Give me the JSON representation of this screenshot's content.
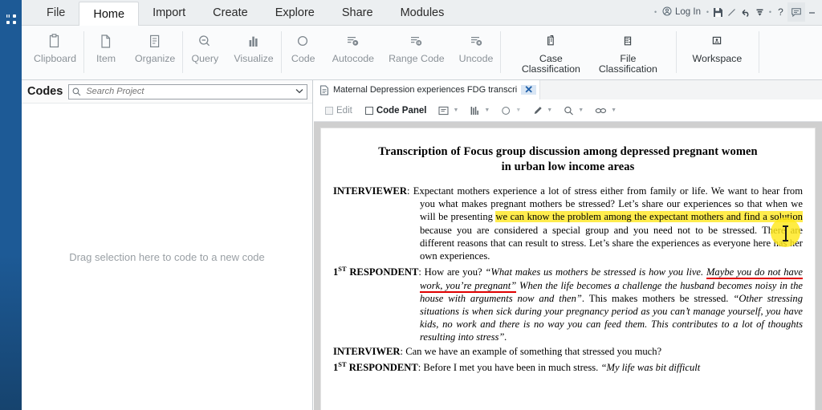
{
  "app": {
    "rail_icon": "apps-grid-icon"
  },
  "ribbon_tabs": [
    {
      "label": "File",
      "active": false
    },
    {
      "label": "Home",
      "active": true
    },
    {
      "label": "Import",
      "active": false
    },
    {
      "label": "Create",
      "active": false
    },
    {
      "label": "Explore",
      "active": false
    },
    {
      "label": "Share",
      "active": false
    },
    {
      "label": "Modules",
      "active": false
    }
  ],
  "top_right": {
    "login_label": "Log In",
    "help_label": "?",
    "icons": [
      "account-circle-icon",
      "save-icon",
      "pencil-icon",
      "undo-icon",
      "redo-dropdown-icon",
      "help-icon",
      "chat-icon",
      "minimize-icon"
    ]
  },
  "ribbon_groups": [
    {
      "buttons": [
        {
          "label": "Clipboard",
          "icon": "clipboard-icon",
          "caret": true,
          "dark": false
        }
      ]
    },
    {
      "buttons": [
        {
          "label": "Item",
          "icon": "file-icon",
          "caret": true,
          "dark": false
        },
        {
          "label": "Organize",
          "icon": "organize-list-icon",
          "caret": true,
          "dark": false
        }
      ]
    },
    {
      "buttons": [
        {
          "label": "Query",
          "icon": "magnifier-icon",
          "caret": true,
          "dark": false
        },
        {
          "label": "Visualize",
          "icon": "bar-chart-icon",
          "caret": true,
          "dark": false
        }
      ]
    },
    {
      "buttons": [
        {
          "label": "Code",
          "icon": "circle-code-icon",
          "caret": true,
          "dark": false
        },
        {
          "label": "Autocode",
          "icon": "autocode-icon",
          "caret": false,
          "dark": false
        },
        {
          "label": "Range Code",
          "icon": "range-code-icon",
          "caret": false,
          "dark": false
        },
        {
          "label": "Uncode",
          "icon": "uncode-icon",
          "caret": true,
          "dark": false
        }
      ]
    },
    {
      "buttons": [
        {
          "label": "Case Classification",
          "icon": "case-classification-icon",
          "caret": true,
          "dark": true
        },
        {
          "label": "File Classification",
          "icon": "file-classification-icon",
          "caret": true,
          "dark": true
        }
      ]
    },
    {
      "buttons": [
        {
          "label": "Workspace",
          "icon": "workspace-icon",
          "caret": true,
          "dark": true
        }
      ]
    }
  ],
  "codes_pane": {
    "title": "Codes",
    "search_placeholder": "Search Project",
    "search_value": "",
    "search_icon": "search-icon",
    "chevron_icon": "chevron-down-icon",
    "empty_hint": "Drag selection here to code to a new code"
  },
  "detail_pane": {
    "tab": {
      "label": "Maternal Depression experiences FDG transcri",
      "icon": "document-icon",
      "close_icon": "close-icon",
      "close_label": "✕"
    },
    "toolbar": {
      "edit_label": "Edit",
      "edit_checked": false,
      "code_panel_label": "Code Panel",
      "code_panel_checked": false,
      "tools": [
        {
          "icon": "text-region-icon",
          "caret": true
        },
        {
          "icon": "coding-stripes-icon",
          "caret": true
        },
        {
          "icon": "highlight-circle-icon",
          "caret": true
        },
        {
          "icon": "pen-highlight-icon",
          "caret": true
        },
        {
          "icon": "zoom-icon",
          "caret": true
        },
        {
          "icon": "link-icon",
          "caret": true
        }
      ]
    }
  },
  "document": {
    "title_line1": "Transcription of Focus group discussion among depressed pregnant women",
    "title_line2": "in urban low income areas",
    "paragraphs": [
      {
        "speaker": "INTERVIEWER",
        "runs": [
          {
            "text": ": Expectant mothers experience a lot of stress either from family or life. We want to hear from you what makes pregnant mothers be stressed? Let’s share our experiences so that when we will be presenting ",
            "style": "plain"
          },
          {
            "text": "we can know the problem among the expectant mothers and find a solution",
            "style": "highlight"
          },
          {
            "text": " because you are considered a special group and you need not to be stressed. There are different reasons that can result to stress. Let’s share the experiences as everyone here has her own experiences.",
            "style": "plain"
          }
        ]
      },
      {
        "speaker": "1ST RESPONDENT",
        "speaker_sup": "ST",
        "speaker_pre": "1",
        "speaker_post": " RESPONDENT",
        "runs": [
          {
            "text": ": How are you? ",
            "style": "plain"
          },
          {
            "text": "“What makes us mothers be stressed is how you live. ",
            "style": "italic"
          },
          {
            "text": "Maybe you do not have work, you’re pregnant”",
            "style": "italic-underline-red"
          },
          {
            "text": " When the life becomes a challenge the husband becomes noisy in the house with arguments now and then”",
            "style": "italic"
          },
          {
            "text": ". This makes mothers be stressed. ",
            "style": "plain"
          },
          {
            "text": "“Other stressing situations is when sick during your pregnancy period as you can’t manage yourself, you have kids, no work and there is no way you can feed them. This contributes to a lot of thoughts resulting into stress”.",
            "style": "italic"
          }
        ]
      },
      {
        "speaker": "INTERVIWER",
        "runs": [
          {
            "text": ": Can we have an example of something that stressed you much?",
            "style": "plain"
          }
        ]
      },
      {
        "speaker": "1ST RESPONDENT",
        "speaker_sup": "ST",
        "speaker_pre": "1",
        "speaker_post": " RESPONDENT",
        "runs": [
          {
            "text": ": Before I met you have been in much stress. ",
            "style": "plain"
          },
          {
            "text": "“My life was bit difficult",
            "style": "italic"
          }
        ]
      }
    ]
  },
  "colors": {
    "rail_blue": "#1d5a96",
    "highlight_yellow": "#ffec4d",
    "underline_red": "#e00000",
    "tab_active_bg": "#ffffff",
    "ribbon_bg": "#fafbfc"
  }
}
